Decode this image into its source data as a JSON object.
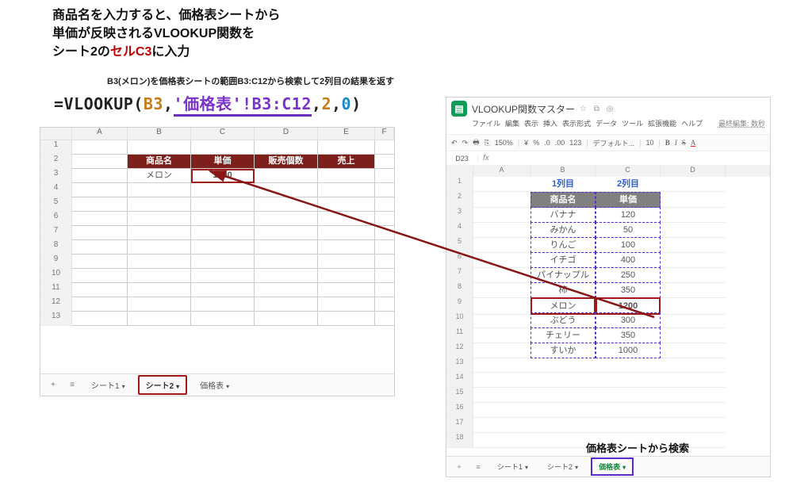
{
  "heading": {
    "line1": "商品名を入力すると、価格表シートから",
    "line2": "単価が反映されるVLOOKUP関数を",
    "line3a": "シート2の",
    "line3b_red": "セルC3",
    "line3c": "に入力"
  },
  "subnote": "B3(メロン)を価格表シートの範囲B3:C12から検索して2列目の結果を返す",
  "formula": {
    "eq": "=",
    "func": "VLOOKUP",
    "open": "(",
    "arg1": "B3",
    "comma": ",",
    "range_q1": "'",
    "range_name": "価格表",
    "range_q2": "'!B3:C12",
    "col": "2",
    "zero": "0",
    "close": ")"
  },
  "left_sheet": {
    "cols": [
      "",
      "A",
      "B",
      "C",
      "D",
      "E",
      "F"
    ],
    "header_row": {
      "num": "2",
      "b": "商品名",
      "c": "単価",
      "d": "販売個数",
      "e": "売上"
    },
    "data_row": {
      "num": "3",
      "b": "メロン",
      "c": "1200"
    },
    "empty_nums": [
      "1",
      "4",
      "5",
      "6",
      "7",
      "8",
      "9",
      "10",
      "11",
      "12",
      "13"
    ],
    "tabs": {
      "plus": "+",
      "menu": "≡",
      "t1": "シート1",
      "t2": "シート2",
      "t3": "価格表",
      "dd": "▾"
    }
  },
  "right_sheet": {
    "docname": "VLOOKUP関数マスター",
    "docicons": "☆ ⧉ ◎",
    "menus": [
      "ファイル",
      "編集",
      "表示",
      "挿入",
      "表示形式",
      "データ",
      "ツール",
      "拡張機能",
      "ヘルプ"
    ],
    "last_edit": "最終編集: 数秒",
    "toolbar": {
      "undo": "↶",
      "redo": "↷",
      "print": "🖶",
      "paint": "⎘",
      "zoom": "150%",
      "sep": "|",
      "cur": "¥",
      "pct": "%",
      "dec0": ".0",
      "dec00": ".00",
      "num": "123",
      "font": "デフォルト...",
      "size": "10",
      "bold": "B",
      "italic": "I",
      "strike": "S",
      "color": "A"
    },
    "fx": {
      "cell": "D23",
      "label": "fx"
    },
    "cols": [
      "",
      "A",
      "B",
      "C",
      "D"
    ],
    "col_labels": {
      "b": "1列目",
      "c": "2列目"
    },
    "header_row": {
      "num": "2",
      "b": "商品名",
      "c": "単価"
    },
    "rows": [
      {
        "num": "3",
        "b": "バナナ",
        "c": "120"
      },
      {
        "num": "4",
        "b": "みかん",
        "c": "50"
      },
      {
        "num": "5",
        "b": "りんご",
        "c": "100"
      },
      {
        "num": "6",
        "b": "イチゴ",
        "c": "400"
      },
      {
        "num": "7",
        "b": "パイナップル",
        "c": "250"
      },
      {
        "num": "8",
        "b": "柿",
        "c": "350"
      },
      {
        "num": "9",
        "b": "メロン",
        "c": "1200",
        "match": true
      },
      {
        "num": "10",
        "b": "ぶどう",
        "c": "300"
      },
      {
        "num": "11",
        "b": "チェリー",
        "c": "350"
      },
      {
        "num": "12",
        "b": "すいか",
        "c": "1000"
      }
    ],
    "extra_nums": [
      "1",
      "13",
      "14",
      "15",
      "16",
      "17",
      "18"
    ],
    "search_note": "価格表シートから検索",
    "tabs": {
      "plus": "+",
      "menu": "≡",
      "t1": "シート1",
      "t2": "シート2",
      "t3": "価格表",
      "dd": "▾"
    }
  },
  "chart_data": {
    "type": "table",
    "title": "価格表",
    "columns": [
      "商品名",
      "単価"
    ],
    "rows": [
      [
        "バナナ",
        120
      ],
      [
        "みかん",
        50
      ],
      [
        "りんご",
        100
      ],
      [
        "イチゴ",
        400
      ],
      [
        "パイナップル",
        250
      ],
      [
        "柿",
        350
      ],
      [
        "メロン",
        1200
      ],
      [
        "ぶどう",
        300
      ],
      [
        "チェリー",
        350
      ],
      [
        "すいか",
        1000
      ]
    ],
    "lookup": {
      "sheet": "シート2",
      "cell": "C3",
      "formula": "=VLOOKUP(B3,'価格表'!B3:C12,2,0)",
      "key": "メロン",
      "result": 1200
    }
  }
}
